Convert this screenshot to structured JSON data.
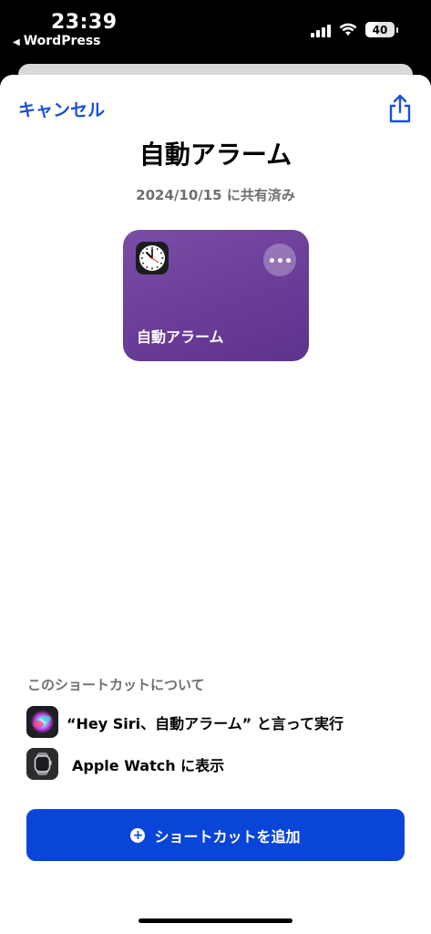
{
  "status_bar": {
    "time": "23:39",
    "back_app": "WordPress",
    "battery": "40"
  },
  "header": {
    "cancel_label": "キャンセル",
    "share_icon": "share-icon"
  },
  "shortcut": {
    "title": "自動アラーム",
    "shared_date": "2024/10/15 に共有済み",
    "card_name": "自動アラーム",
    "card_color": "#6a3d99",
    "icon": "clock-icon"
  },
  "about": {
    "heading": "このショートカットについて",
    "siri_phrase": "“Hey Siri、自動アラーム” と言って実行",
    "watch_label": "Apple Watch に表示"
  },
  "action": {
    "add_label": "ショートカットを追加",
    "accent": "#0a45d9"
  }
}
